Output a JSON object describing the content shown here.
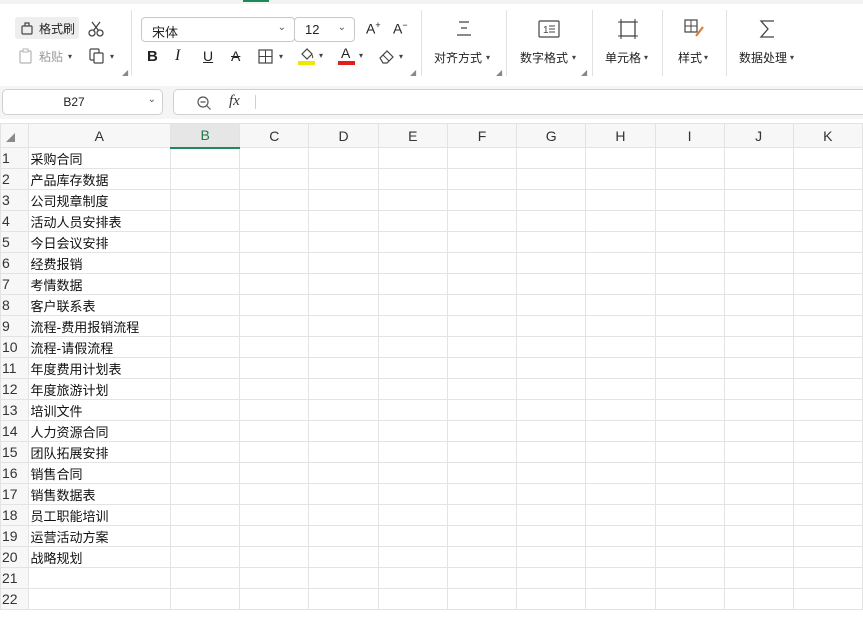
{
  "ribbon": {
    "format_painter": "格式刷",
    "paste": "粘贴",
    "font_name": "宋体",
    "font_size": "12",
    "bold": "B",
    "italic": "I",
    "underline": "U",
    "strikethrough": "A",
    "font_color_letter": "A",
    "align_label": "对齐方式",
    "number_format_label": "数字格式",
    "cell_label": "单元格",
    "style_label": "样式",
    "data_process_label": "数据处理",
    "highlight_color": "#f2e600",
    "font_color": "#e0201b",
    "accent_color": "#1e8a5b"
  },
  "formula_bar": {
    "cell_ref": "B27",
    "fx": "fx",
    "formula": ""
  },
  "grid": {
    "columns": [
      "A",
      "B",
      "C",
      "D",
      "E",
      "F",
      "G",
      "H",
      "I",
      "J",
      "K"
    ],
    "selected_column": "B",
    "rows": [
      {
        "num": "1",
        "a": "采购合同"
      },
      {
        "num": "2",
        "a": "产品库存数据"
      },
      {
        "num": "3",
        "a": "公司规章制度"
      },
      {
        "num": "4",
        "a": "活动人员安排表"
      },
      {
        "num": "5",
        "a": "今日会议安排"
      },
      {
        "num": "6",
        "a": "经费报销"
      },
      {
        "num": "7",
        "a": "考情数据"
      },
      {
        "num": "8",
        "a": "客户联系表"
      },
      {
        "num": "9",
        "a": "流程-费用报销流程"
      },
      {
        "num": "10",
        "a": "流程-请假流程"
      },
      {
        "num": "11",
        "a": "年度费用计划表"
      },
      {
        "num": "12",
        "a": "年度旅游计划"
      },
      {
        "num": "13",
        "a": "培训文件"
      },
      {
        "num": "14",
        "a": "人力资源合同"
      },
      {
        "num": "15",
        "a": "团队拓展安排"
      },
      {
        "num": "16",
        "a": "销售合同"
      },
      {
        "num": "17",
        "a": "销售数据表"
      },
      {
        "num": "18",
        "a": "员工职能培训"
      },
      {
        "num": "19",
        "a": "运营活动方案"
      },
      {
        "num": "20",
        "a": "战略规划"
      },
      {
        "num": "21",
        "a": ""
      },
      {
        "num": "22",
        "a": ""
      }
    ]
  }
}
